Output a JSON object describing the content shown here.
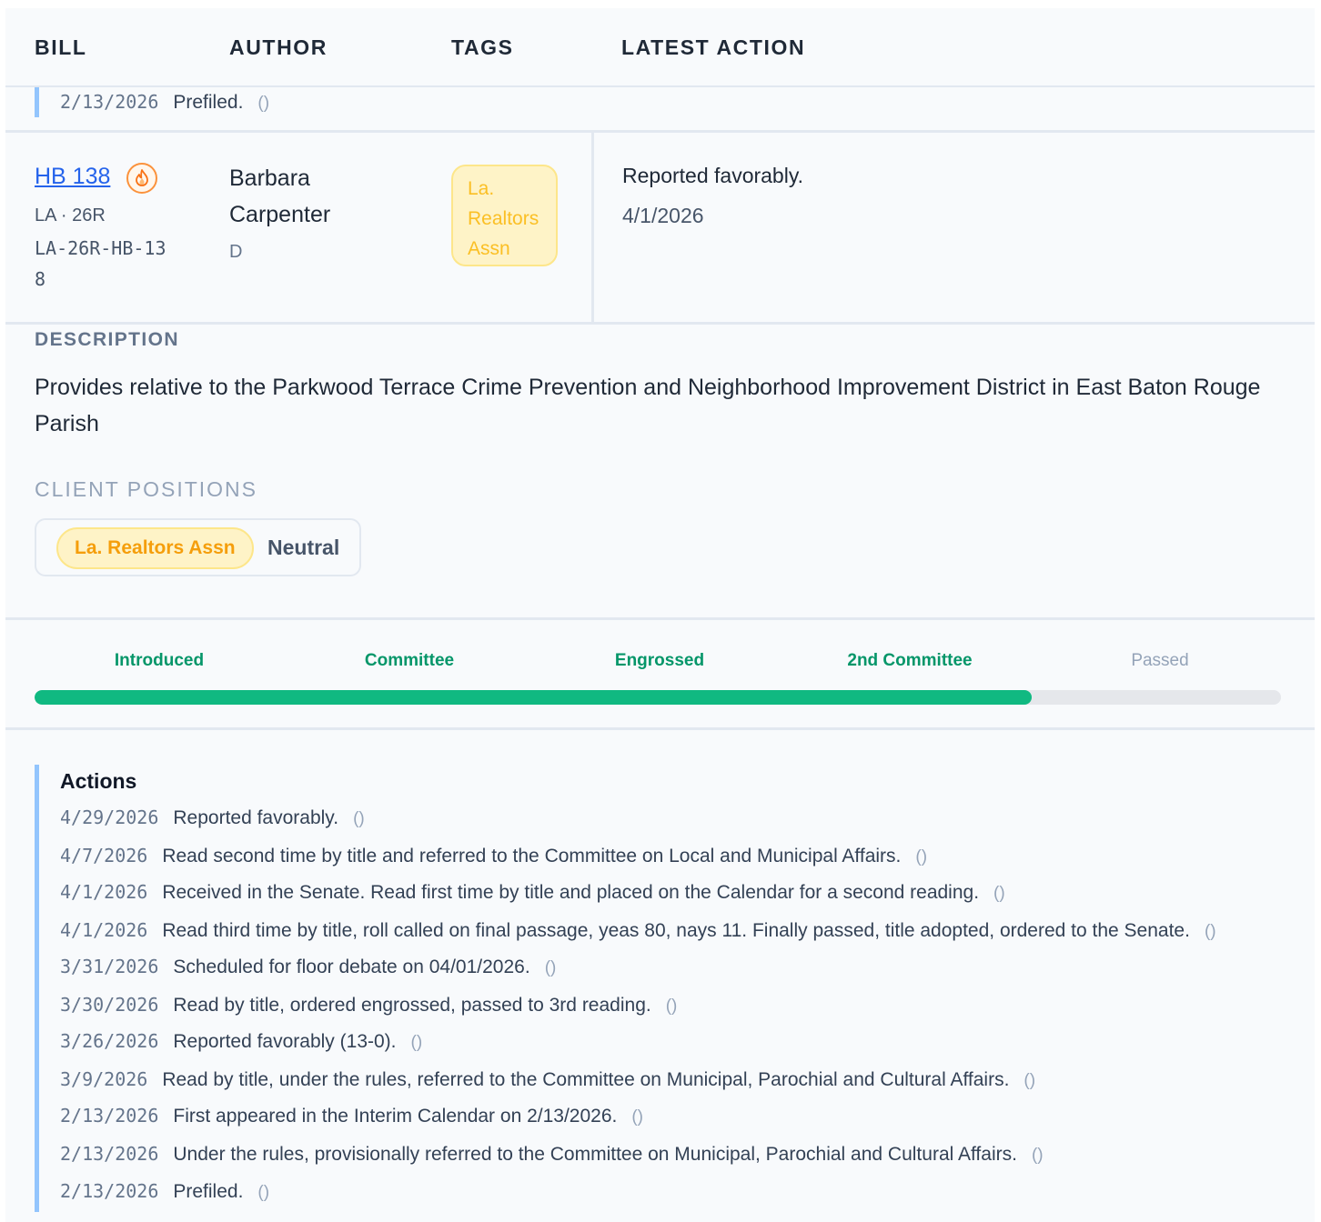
{
  "header": {
    "bill": "BILL",
    "author": "AUTHOR",
    "tags": "TAGS",
    "latest_action": "LATEST ACTION"
  },
  "previous_action": {
    "date": "2/13/2026",
    "text": "Prefiled.",
    "paren": "()"
  },
  "bill": {
    "number": "HB 138",
    "hot_icon": "fire-icon",
    "state_session": "LA · 26R",
    "full_id": "LA-26R-HB-138",
    "author_name": "Barbara Carpenter",
    "author_party": "D",
    "tag": "La. Realtors Assn",
    "latest_action_text": "Reported favorably.",
    "latest_action_date": "4/1/2026"
  },
  "description": {
    "label": "DESCRIPTION",
    "text": "Provides relative to the Parkwood Terrace Crime Prevention and Neighborhood Improvement District in East Baton Rouge Parish"
  },
  "client_positions": {
    "label": "CLIENT POSITIONS",
    "items": [
      {
        "client": "La. Realtors Assn",
        "position": "Neutral"
      }
    ]
  },
  "progress": {
    "stages": [
      {
        "label": "Introduced",
        "done": true
      },
      {
        "label": "Committee",
        "done": true
      },
      {
        "label": "Engrossed",
        "done": true
      },
      {
        "label": "2nd Committee",
        "done": true
      },
      {
        "label": "Passed",
        "done": false
      }
    ],
    "fraction_complete": 0.8
  },
  "actions": {
    "title": "Actions",
    "items": [
      {
        "date": "4/29/2026",
        "text": "Reported favorably.",
        "paren": "()"
      },
      {
        "date": "4/7/2026",
        "text": "Read second time by title and referred to the Committee on Local and Municipal Affairs.",
        "paren": "()"
      },
      {
        "date": "4/1/2026",
        "text": "Received in the Senate. Read first time by title and placed on the Calendar for a second reading.",
        "paren": "()"
      },
      {
        "date": "4/1/2026",
        "text": "Read third time by title, roll called on final passage, yeas 80, nays 11. Finally passed, title adopted, ordered to the Senate.",
        "paren": "()"
      },
      {
        "date": "3/31/2026",
        "text": "Scheduled for floor debate on 04/01/2026.",
        "paren": "()"
      },
      {
        "date": "3/30/2026",
        "text": "Read by title, ordered engrossed, passed to 3rd reading.",
        "paren": "()"
      },
      {
        "date": "3/26/2026",
        "text": "Reported favorably (13-0).",
        "paren": "()"
      },
      {
        "date": "3/9/2026",
        "text": "Read by title, under the rules, referred to the Committee on Municipal, Parochial and Cultural Affairs.",
        "paren": "()"
      },
      {
        "date": "2/13/2026",
        "text": "First appeared in the Interim Calendar on 2/13/2026.",
        "paren": "()"
      },
      {
        "date": "2/13/2026",
        "text": "Under the rules, provisionally referred to the Committee on Municipal, Parochial and Cultural Affairs.",
        "paren": "()"
      },
      {
        "date": "2/13/2026",
        "text": "Prefiled.",
        "paren": "()"
      }
    ]
  },
  "colors": {
    "link": "#2563eb",
    "progress_done": "#10b981",
    "progress_track": "#e5e7eb",
    "tag_bg": "#fef3c7",
    "tag_text": "#fbbf24",
    "accent_bar": "#93c5fd"
  }
}
